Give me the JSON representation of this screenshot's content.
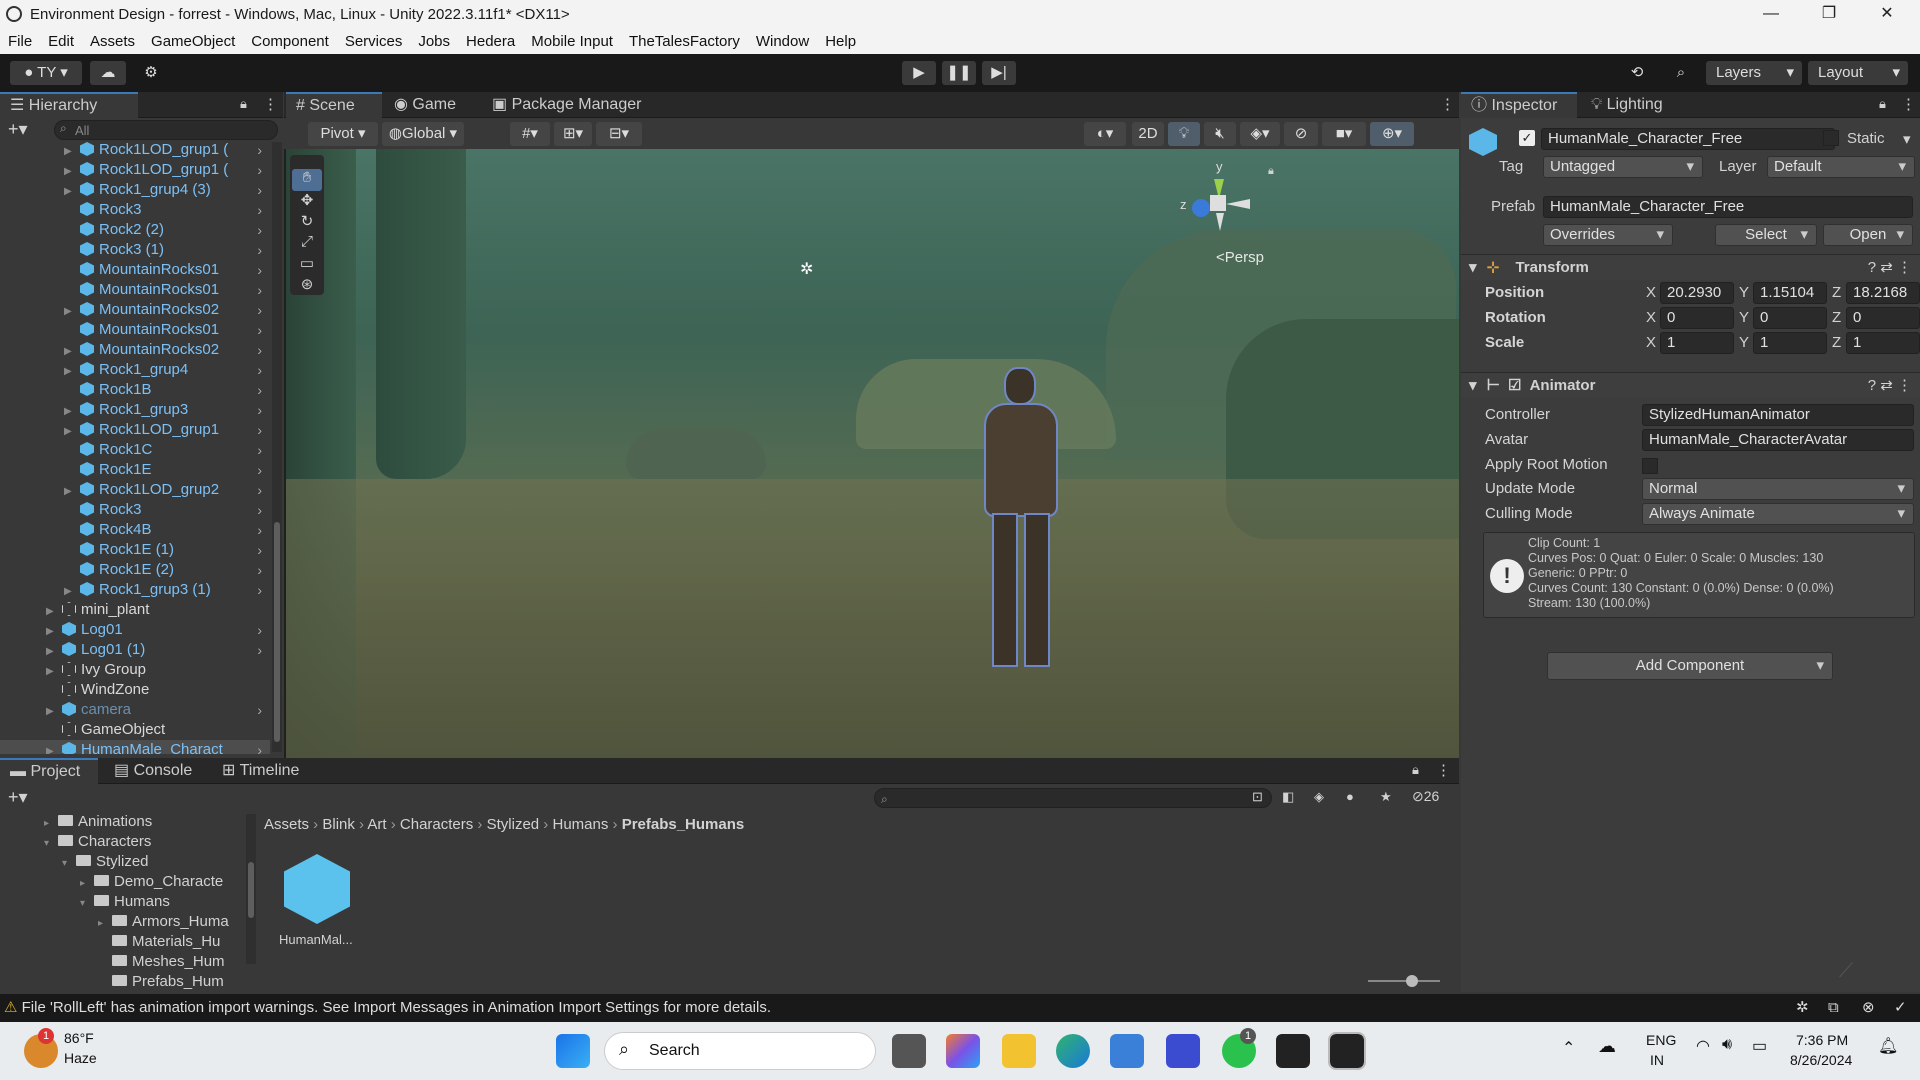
{
  "window": {
    "title": "Environment Design - forrest - Windows, Mac, Linux - Unity 2022.3.11f1* <DX11>",
    "minimize": "—",
    "maximize": "❐",
    "close": "✕"
  },
  "menu": [
    "File",
    "Edit",
    "Assets",
    "GameObject",
    "Component",
    "Services",
    "Jobs",
    "Hedera",
    "Mobile Input",
    "TheTalesFactory",
    "Window",
    "Help"
  ],
  "toolbar": {
    "account": "TY",
    "layers": "Layers",
    "layout": "Layout"
  },
  "hierarchy": {
    "tab": "Hierarchy",
    "search_placeholder": "All",
    "items": [
      {
        "label": "Rock1LOD_grup1 (",
        "expand": true,
        "type": "prefab"
      },
      {
        "label": "Rock1LOD_grup1 (",
        "expand": true,
        "type": "prefab"
      },
      {
        "label": "Rock1_grup4 (3)",
        "expand": true,
        "type": "prefab"
      },
      {
        "label": "Rock3",
        "expand": false,
        "type": "prefab"
      },
      {
        "label": "Rock2 (2)",
        "expand": false,
        "type": "prefab"
      },
      {
        "label": "Rock3 (1)",
        "expand": false,
        "type": "prefab"
      },
      {
        "label": "MountainRocks01",
        "expand": false,
        "type": "prefab"
      },
      {
        "label": "MountainRocks01",
        "expand": false,
        "type": "prefab"
      },
      {
        "label": "MountainRocks02",
        "expand": true,
        "type": "prefab"
      },
      {
        "label": "MountainRocks01",
        "expand": false,
        "type": "prefab"
      },
      {
        "label": "MountainRocks02",
        "expand": true,
        "type": "prefab"
      },
      {
        "label": "Rock1_grup4",
        "expand": true,
        "type": "prefab"
      },
      {
        "label": "Rock1B",
        "expand": false,
        "type": "prefab"
      },
      {
        "label": "Rock1_grup3",
        "expand": true,
        "type": "prefab"
      },
      {
        "label": "Rock1LOD_grup1",
        "expand": true,
        "type": "prefab"
      },
      {
        "label": "Rock1C",
        "expand": false,
        "type": "prefab"
      },
      {
        "label": "Rock1E",
        "expand": false,
        "type": "prefab"
      },
      {
        "label": "Rock1LOD_grup2",
        "expand": true,
        "type": "prefab"
      },
      {
        "label": "Rock3",
        "expand": false,
        "type": "prefab"
      },
      {
        "label": "Rock4B",
        "expand": false,
        "type": "prefab"
      },
      {
        "label": "Rock1E (1)",
        "expand": false,
        "type": "prefab"
      },
      {
        "label": "Rock1E (2)",
        "expand": false,
        "type": "prefab"
      },
      {
        "label": "Rock1_grup3 (1)",
        "expand": true,
        "type": "prefab"
      },
      {
        "label": "mini_plant",
        "expand": true,
        "type": "go",
        "depth": 0
      },
      {
        "label": "Log01",
        "expand": true,
        "type": "prefab",
        "depth": 0
      },
      {
        "label": "Log01 (1)",
        "expand": true,
        "type": "prefab",
        "depth": 0
      },
      {
        "label": "Ivy Group",
        "expand": true,
        "type": "go",
        "depth": 0
      },
      {
        "label": "WindZone",
        "expand": false,
        "type": "go",
        "depth": 0
      },
      {
        "label": "camera",
        "expand": true,
        "type": "prefab",
        "depth": 0,
        "disabled": true
      },
      {
        "label": "GameObject",
        "expand": false,
        "type": "go",
        "depth": 0
      },
      {
        "label": "HumanMale_Charact",
        "expand": true,
        "type": "prefab",
        "depth": 0,
        "selected": true
      }
    ]
  },
  "scene": {
    "tabs": [
      "Scene",
      "Game",
      "Package Manager"
    ],
    "pivot": "Pivot",
    "global": "Global",
    "mode2d": "2D",
    "persp": "<Persp",
    "gizmo_y": "y",
    "gizmo_z": "z"
  },
  "inspector": {
    "tabs": [
      "Inspector",
      "Lighting"
    ],
    "name": "HumanMale_Character_Free",
    "static": "Static",
    "tag_label": "Tag",
    "tag": "Untagged",
    "layer_label": "Layer",
    "layer": "Default",
    "prefab_label": "Prefab",
    "prefab": "HumanMale_Character_Free",
    "overrides": "Overrides",
    "select": "Select",
    "open": "Open",
    "transform": {
      "title": "Transform",
      "rows": [
        {
          "label": "Position",
          "x": "20.2930",
          "y": "1.15104",
          "z": "18.2168"
        },
        {
          "label": "Rotation",
          "x": "0",
          "y": "0",
          "z": "0"
        },
        {
          "label": "Scale",
          "x": "1",
          "y": "1",
          "z": "1"
        }
      ]
    },
    "animator": {
      "title": "Animator",
      "controller_label": "Controller",
      "controller": "StylizedHumanAnimator",
      "avatar_label": "Avatar",
      "avatar": "HumanMale_CharacterAvatar",
      "root_motion_label": "Apply Root Motion",
      "update_label": "Update Mode",
      "update": "Normal",
      "culling_label": "Culling Mode",
      "culling": "Always Animate",
      "info": [
        "Clip Count: 1",
        "Curves Pos: 0 Quat: 0 Euler: 0 Scale: 0 Muscles: 130",
        "Generic: 0 PPtr: 0",
        "Curves Count: 130 Constant: 0 (0.0%) Dense: 0 (0.0%)",
        "Stream: 130 (100.0%)"
      ]
    },
    "add_component": "Add Component"
  },
  "project": {
    "tabs": [
      "Project",
      "Console",
      "Timeline"
    ],
    "hidden_count": "26",
    "tree": [
      {
        "label": "Animations",
        "depth": 0,
        "expand": "▸"
      },
      {
        "label": "Characters",
        "depth": 0,
        "expand": "▾"
      },
      {
        "label": "Stylized",
        "depth": 1,
        "expand": "▾"
      },
      {
        "label": "Demo_Characte",
        "depth": 2,
        "expand": "▸"
      },
      {
        "label": "Humans",
        "depth": 2,
        "expand": "▾"
      },
      {
        "label": "Armors_Huma",
        "depth": 3,
        "expand": "▸"
      },
      {
        "label": "Materials_Hu",
        "depth": 3,
        "expand": ""
      },
      {
        "label": "Meshes_Hum",
        "depth": 3,
        "expand": ""
      },
      {
        "label": "Prefabs_Hum",
        "depth": 3,
        "expand": ""
      }
    ],
    "breadcrumb": [
      "Assets",
      "Blink",
      "Art",
      "Characters",
      "Stylized",
      "Humans",
      "Prefabs_Humans"
    ],
    "asset": "HumanMal..."
  },
  "status": {
    "message": "File 'RollLeft' has animation import warnings. See Import Messages in Animation Import Settings for more details."
  },
  "taskbar": {
    "weather_temp": "86°F",
    "weather_desc": "Haze",
    "weather_badge": "1",
    "search": "Search",
    "lang1": "ENG",
    "lang2": "IN",
    "time": "7:36 PM",
    "date": "8/26/2024",
    "whatsapp_badge": "1"
  }
}
